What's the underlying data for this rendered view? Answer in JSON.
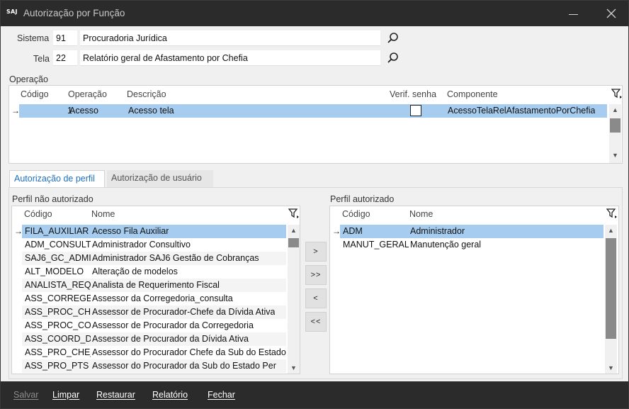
{
  "window": {
    "logo": "SAJ",
    "title": "Autorização por Função"
  },
  "sistema": {
    "label": "Sistema",
    "code": "91",
    "name": "Procuradoria Jurídica"
  },
  "tela": {
    "label": "Tela",
    "code": "22",
    "name": "Relatório geral de Afastamento por Chefia"
  },
  "operacao": {
    "section_label": "Operação",
    "headers": {
      "codigo": "Código",
      "operacao": "Operação",
      "descricao": "Descrição",
      "verif": "Verif. senha",
      "componente": "Componente"
    },
    "rows": [
      {
        "codigo": "1",
        "operacao": "Acesso",
        "descricao": "Acesso  tela",
        "verif_checked": false,
        "componente": "AcessoTelaRelAfastamentoPorChefia"
      }
    ]
  },
  "tabs": [
    {
      "label": "Autorização de perfil",
      "active": true
    },
    {
      "label": "Autorização de usuário",
      "active": false
    }
  ],
  "left_list": {
    "title": "Perfil não autorizado",
    "headers": {
      "codigo": "Código",
      "nome": "Nome"
    },
    "rows": [
      {
        "codigo": "FILA_AUXILIAR",
        "nome": "Acesso Fila Auxiliar"
      },
      {
        "codigo": "ADM_CONSULT",
        "nome": "Administrador Consultivo"
      },
      {
        "codigo": "SAJ6_GC_ADMI",
        "nome": "Administrador SAJ6 Gestão de Cobranças"
      },
      {
        "codigo": "ALT_MODELO",
        "nome": "Alteração de modelos"
      },
      {
        "codigo": "ANALISTA_REQ",
        "nome": "Analista de Requerimento Fiscal"
      },
      {
        "codigo": "ASS_CORREGEI",
        "nome": "Assessor da Corregedoria_consulta"
      },
      {
        "codigo": "ASS_PROC_CHE",
        "nome": "Assessor de Procurador-Chefe da Dívida Ativa"
      },
      {
        "codigo": "ASS_PROC_COR",
        "nome": "Assessor de Procurador da Corregedoria"
      },
      {
        "codigo": "ASS_COORD_DI",
        "nome": "Assessor de Procurador da Dívida Ativa"
      },
      {
        "codigo": "ASS_PRO_CHE_",
        "nome": "Assessor do Procurador Chefe da Sub do Estado"
      },
      {
        "codigo": "ASS_PRO_PTS",
        "nome": "Assessor do Procurador da Sub do Estado Per"
      }
    ]
  },
  "right_list": {
    "title": "Perfil autorizado",
    "headers": {
      "codigo": "Código",
      "nome": "Nome"
    },
    "rows": [
      {
        "codigo": "ADM",
        "nome": "Administrador"
      },
      {
        "codigo": "MANUT_GERAL",
        "nome": "Manutenção geral"
      }
    ]
  },
  "transfer_buttons": [
    ">",
    ">>",
    "<",
    "<<"
  ],
  "footer": {
    "salvar": "Salvar",
    "limpar": "Limpar",
    "restaurar": "Restaurar",
    "relatorio": "Relatório",
    "fechar": "Fechar"
  },
  "row_arrow": "→",
  "colors": {
    "selection": "#a6cdf0",
    "titlebar": "#2b2b2b",
    "active_tab": "#1f6fc0"
  }
}
